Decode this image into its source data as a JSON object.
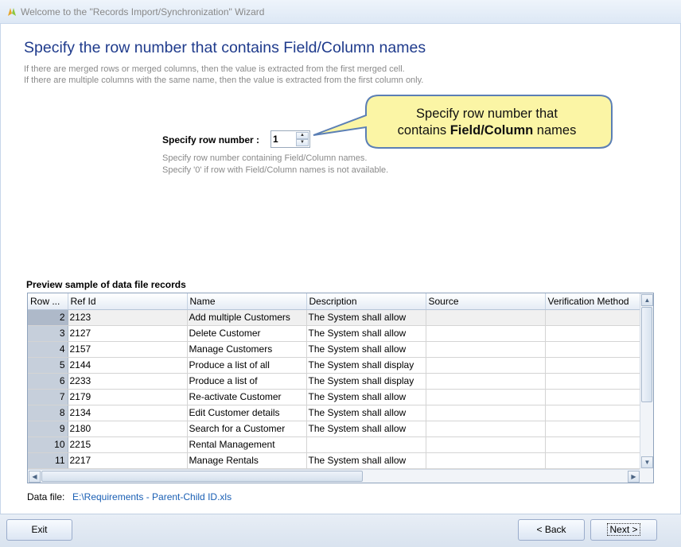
{
  "window": {
    "title": "Welcome to the \"Records Import/Synchronization\" Wizard"
  },
  "page": {
    "heading": "Specify the row number that contains Field/Column names",
    "info_line1": "If there are merged rows or merged columns, then the value is extracted from the first merged cell.",
    "info_line2": "If there are multiple columns with the same name, then the value is extracted from the first column only."
  },
  "row_number": {
    "label": "Specify row number :",
    "value": "1",
    "hint1": "Specify row number containing Field/Column names.",
    "hint2": "Specify '0' if row with Field/Column names is not available."
  },
  "callout": {
    "line1": "Specify row number that",
    "line2_prefix": "contains ",
    "line2_bold": "Field/Column",
    "line2_suffix": " names",
    "fill": "#fbf5a5",
    "border": "#5b7fb5"
  },
  "preview": {
    "label": "Preview sample of data file records",
    "columns": [
      "Row ...",
      "Ref Id",
      "Name",
      "Description",
      "Source",
      "Verification Method"
    ],
    "rows": [
      [
        "2",
        "2123",
        "Add  multiple Customers",
        "The System shall allow",
        "",
        ""
      ],
      [
        "3",
        "2127",
        "Delete Customer",
        "The System shall allow",
        "",
        ""
      ],
      [
        "4",
        "2157",
        "Manage Customers",
        "The System shall allow",
        "",
        ""
      ],
      [
        "5",
        "2144",
        "Produce a list of all",
        "The System shall display",
        "",
        ""
      ],
      [
        "6",
        "2233",
        "Produce a list of",
        "The System shall display",
        "",
        ""
      ],
      [
        "7",
        "2179",
        "Re-activate Customer",
        "The System shall allow",
        "",
        ""
      ],
      [
        "8",
        "2134",
        "Edit Customer details",
        "The System shall allow",
        "",
        ""
      ],
      [
        "9",
        "2180",
        "Search for a Customer",
        "The System shall allow",
        "",
        ""
      ],
      [
        "10",
        "2215",
        "Rental Management",
        "",
        "",
        ""
      ],
      [
        "11",
        "2217",
        "Manage Rentals",
        "The System shall allow",
        "",
        ""
      ]
    ],
    "selected_row": 0
  },
  "data_file": {
    "label": "Data file:",
    "value": "E:\\Requirements - Parent-Child ID.xls"
  },
  "buttons": {
    "exit": "Exit",
    "back": "< Back",
    "next": "Next >"
  },
  "icons": {
    "app": "app-logo-icon",
    "up": "chevron-up-icon",
    "down": "chevron-down-icon",
    "left": "chevron-left-icon",
    "right": "chevron-right-icon"
  },
  "colors": {
    "heading": "#1f3b8c",
    "link": "#1a5fb4",
    "rownum_bg": "#c6cfdb"
  }
}
